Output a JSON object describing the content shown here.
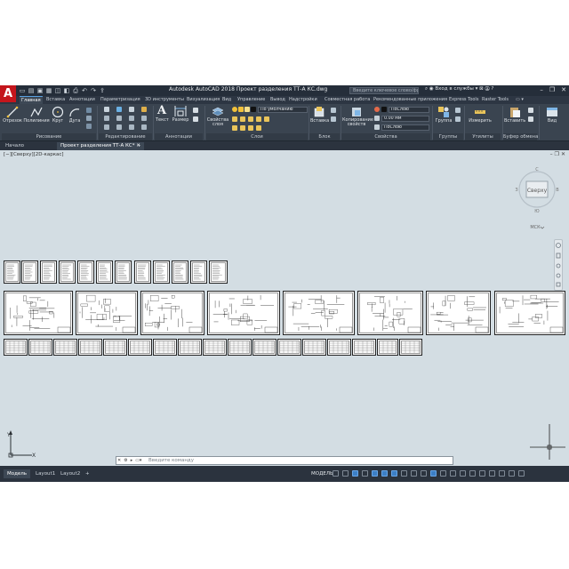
{
  "app": {
    "logo": "A",
    "title": "Autodesk AutoCAD 2018    Проект разделения ТТ-А КС.dwg",
    "search_placeholder": "Введите ключевое слово/фразу",
    "user": "Вход в службы",
    "help": "?"
  },
  "ribbon_tabs": [
    "Главная",
    "Вставка",
    "Аннотации",
    "Параметризация",
    "3D инструменты",
    "Визуализация",
    "Вид",
    "Управление",
    "Вывод",
    "Надстройки",
    "Совместная работа",
    "Рекомендованные приложения",
    "Express Tools",
    "Raster Tools"
  ],
  "ribbon": {
    "draw": {
      "line": "Отрезок",
      "polyline": "Полилиния",
      "circle": "Круг",
      "arc": "Дуга",
      "title": "Рисование"
    },
    "modify": {
      "title": "Редактирование"
    },
    "annotation": {
      "text": "Текст",
      "dimension": "Размер",
      "title": "Аннотации"
    },
    "layers": {
      "properties": "Свойства слоя",
      "current": "По умолчанию",
      "title": "Слои"
    },
    "block": {
      "insert": "Вставка",
      "title": "Блок"
    },
    "properties": {
      "match": "Копирование свойств",
      "color": "ПоСлою",
      "lineweight": "0.00 мм",
      "linetype": "ПоСлою",
      "title": "Свойства"
    },
    "groups": {
      "group": "Группа",
      "title": "Группы"
    },
    "utilities": {
      "measure": "Измерить",
      "title": "Утилиты"
    },
    "clipboard": {
      "paste": "Вставить",
      "title": "Буфер обмена"
    },
    "view": {
      "view": "Вид"
    }
  },
  "doc_tabs": [
    "Начало",
    "Проект разделения ТТ-А КС*"
  ],
  "viewport": {
    "label": "[−][Сверху][2D-каркас]",
    "viewcube_face": "Сверху",
    "compass_n": "С",
    "compass_s": "Ю",
    "compass_w": "З",
    "compass_e": "В",
    "wcs": "МСК"
  },
  "ucs": {
    "x": "X",
    "y": "Y"
  },
  "command": {
    "placeholder": "Введите команду"
  },
  "status": {
    "layouts": [
      "Модель",
      "Layout1",
      "Layout2"
    ],
    "add": "+",
    "space": "МОДЕЛЬ"
  }
}
